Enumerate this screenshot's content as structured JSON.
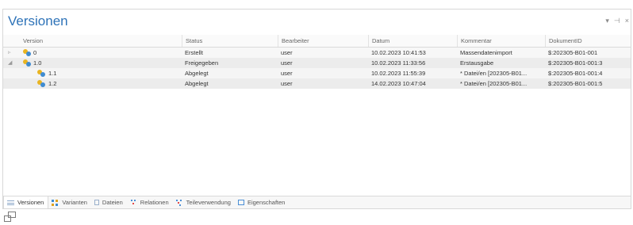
{
  "panel": {
    "title": "Versionen",
    "controls": {
      "dropdown": "▾",
      "pin": "⊣",
      "close": "×"
    }
  },
  "columns": [
    "Version",
    "Status",
    "Bearbeiter",
    "Datum",
    "Kommentar",
    "DokumentID"
  ],
  "rows": [
    {
      "expander": "▹",
      "version": "0",
      "status": "Erstellt",
      "bearbeiter": "user",
      "datum": "10.02.2023 10:41:53",
      "kommentar": "Massendatenimport",
      "dokumentid": "$:202305-B01-001"
    },
    {
      "expander": "◢",
      "version": "1.0",
      "status": "Freigegeben",
      "bearbeiter": "user",
      "datum": "10.02.2023 11:33:56",
      "kommentar": "Erstausgabe",
      "dokumentid": "$:202305-B01-001:3"
    },
    {
      "expander": "",
      "version": "1.1",
      "status": "Abgelegt",
      "bearbeiter": "user",
      "datum": "10.02.2023 11:55:39",
      "kommentar": "* Datei/en [202305-B01...",
      "dokumentid": "$:202305-B01-001:4"
    },
    {
      "expander": "",
      "version": "1.2",
      "status": "Abgelegt",
      "bearbeiter": "user",
      "datum": "14.02.2023 10:47:04",
      "kommentar": "* Datei/en [202305-B01...",
      "dokumentid": "$:202305-B01-001:5"
    }
  ],
  "tabs": [
    {
      "label": "Versionen",
      "icon": "list-icon",
      "active": true
    },
    {
      "label": "Varianten",
      "icon": "variants-icon",
      "active": false
    },
    {
      "label": "Dateien",
      "icon": "file-icon",
      "active": false
    },
    {
      "label": "Relationen",
      "icon": "relations-icon",
      "active": false
    },
    {
      "label": "Teileverwendung",
      "icon": "part-usage-icon",
      "active": false
    },
    {
      "label": "Eigenschaften",
      "icon": "properties-icon",
      "active": false
    }
  ],
  "colors": {
    "title": "#2e73b8",
    "version_icon_primary": "#e8b422",
    "version_icon_secondary": "#3f8bd1"
  }
}
